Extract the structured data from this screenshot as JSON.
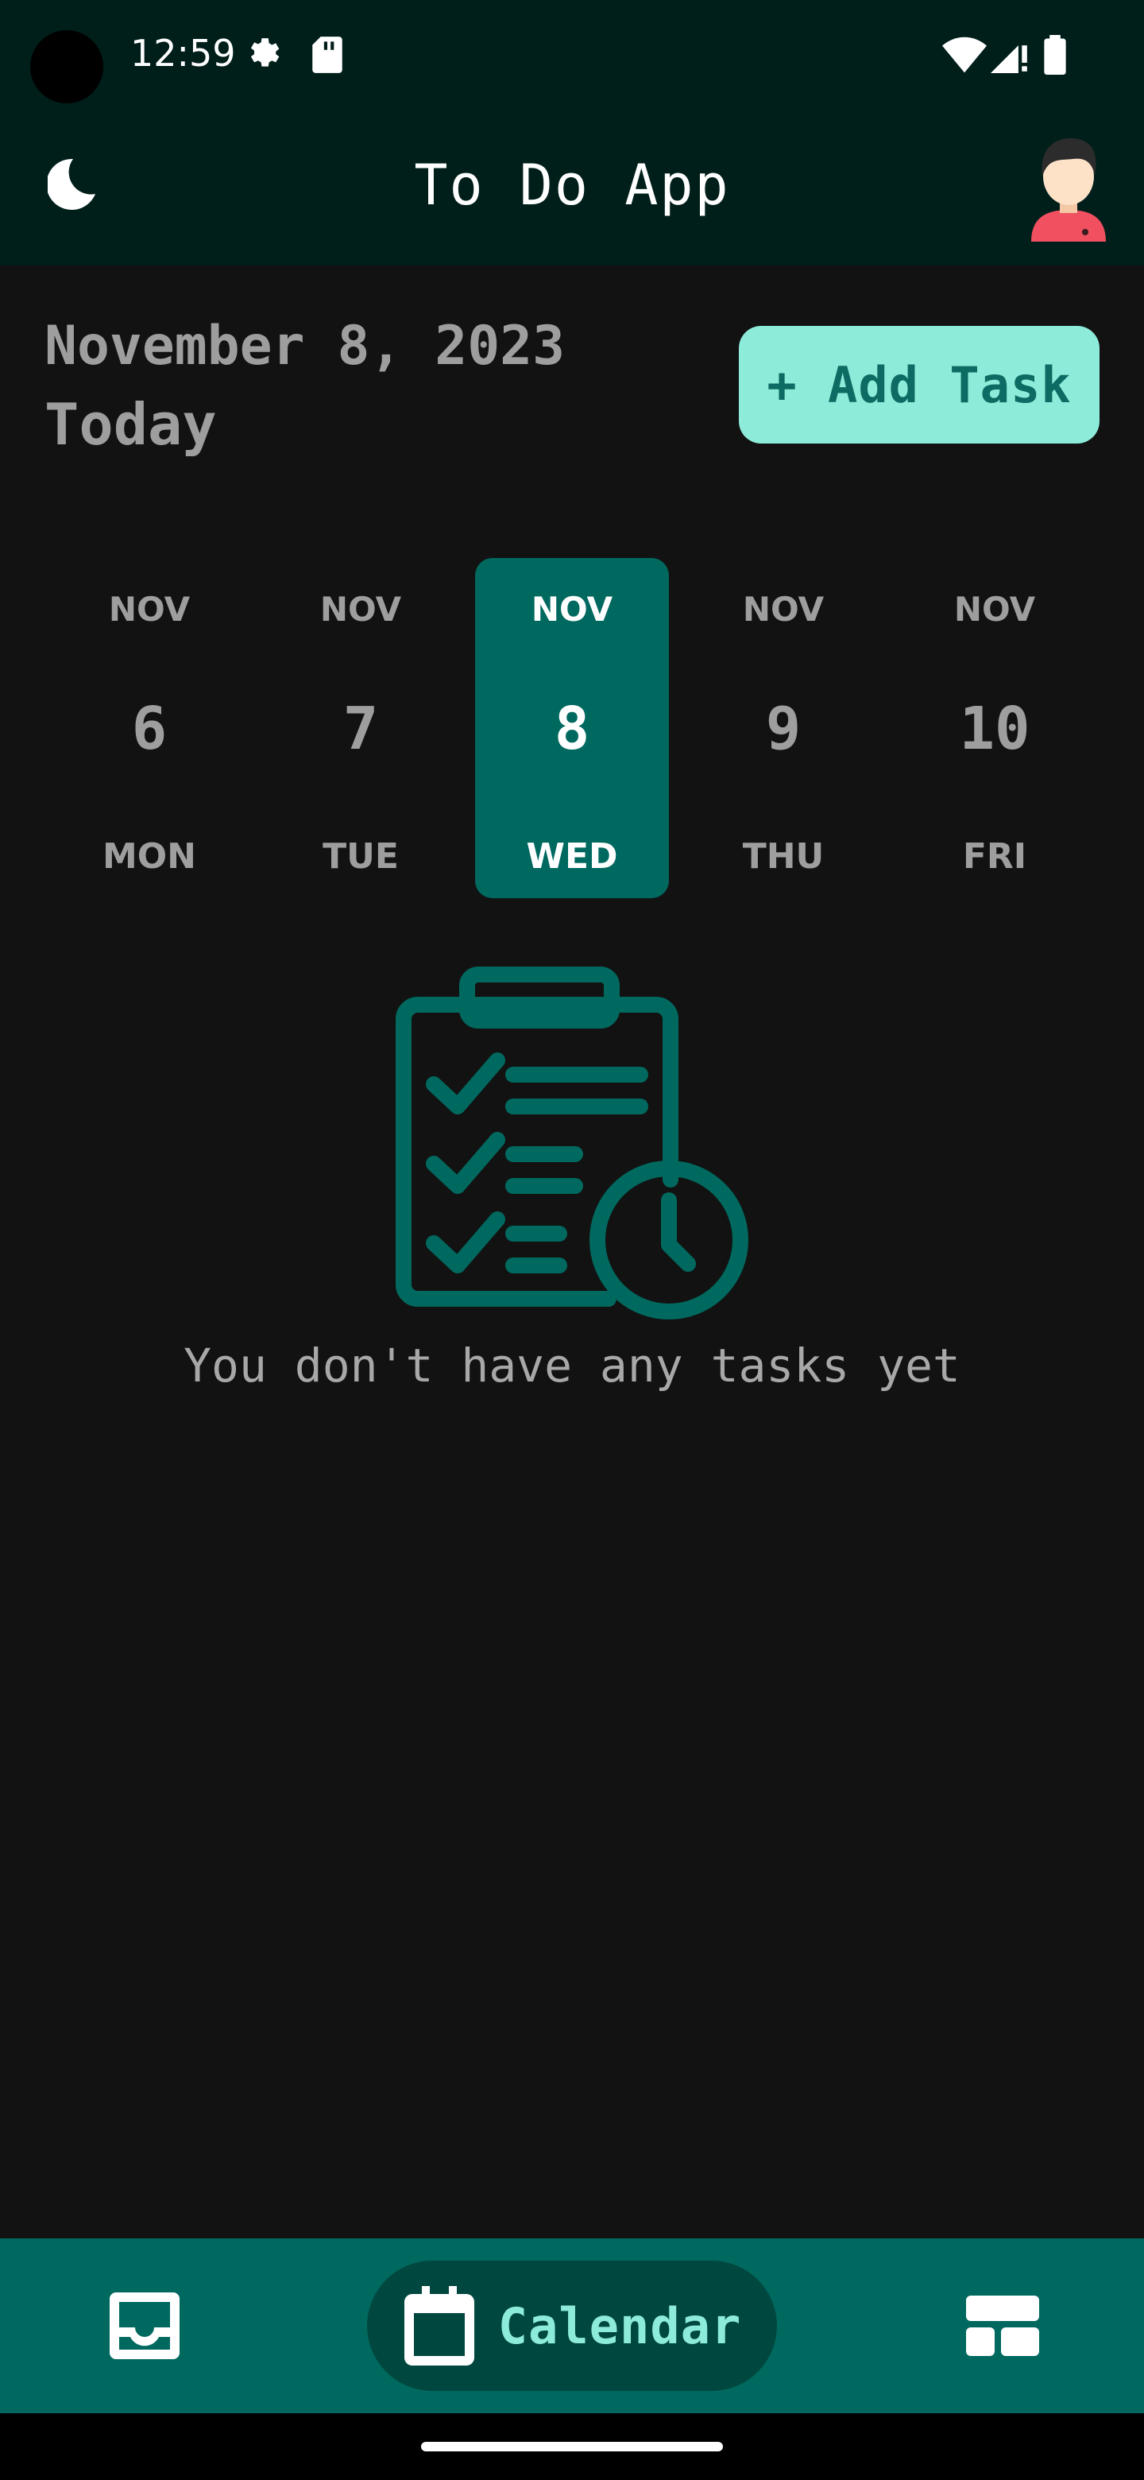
{
  "status_bar": {
    "time": "12:59"
  },
  "app_bar": {
    "title": "To Do App"
  },
  "header": {
    "date": "November 8, 2023",
    "subtitle": "Today",
    "add_task_label": "+ Add Task"
  },
  "date_strip": {
    "days": [
      {
        "month": "NOV",
        "day": "6",
        "weekday": "MON",
        "selected": false
      },
      {
        "month": "NOV",
        "day": "7",
        "weekday": "TUE",
        "selected": false
      },
      {
        "month": "NOV",
        "day": "8",
        "weekday": "WED",
        "selected": true
      },
      {
        "month": "NOV",
        "day": "9",
        "weekday": "THU",
        "selected": false
      },
      {
        "month": "NOV",
        "day": "10",
        "weekday": "FRI",
        "selected": false
      }
    ]
  },
  "empty_state": {
    "message": "You don't have any tasks yet"
  },
  "bottom_nav": {
    "items": [
      {
        "name": "inbox",
        "icon": "inbox-icon",
        "label": ""
      },
      {
        "name": "calendar",
        "icon": "calendar-icon",
        "label": "Calendar",
        "active": true
      },
      {
        "name": "board",
        "icon": "dashboard-icon",
        "label": ""
      }
    ]
  },
  "colors": {
    "app_bar_bg": "#001e1a",
    "background": "#121212",
    "accent": "#00695f",
    "accent_light": "#8debd9",
    "accent_dark": "#00483f"
  }
}
